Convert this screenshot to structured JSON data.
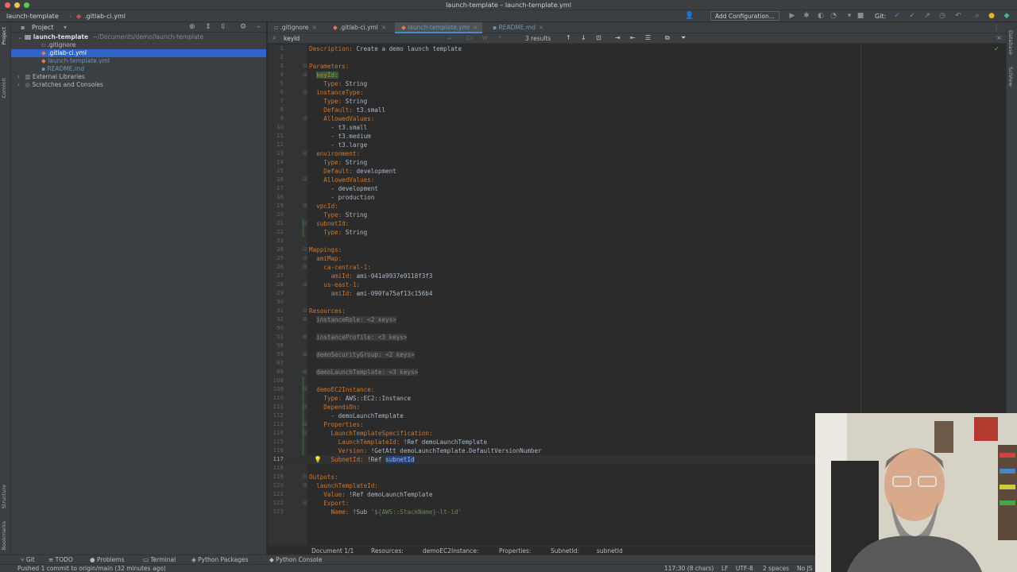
{
  "window": {
    "title": "launch-template – launch-template.yml"
  },
  "navbar": {
    "project": "launch-template",
    "file": ".gitlab-ci.yml",
    "add_configuration": "Add Configuration...",
    "git_label": "Git:"
  },
  "left_strip": {
    "project_tab": "Project",
    "commit_tab": "Commit",
    "structure_tab": "Structure",
    "bookmarks_tab": "Bookmarks"
  },
  "right_strip": {
    "database_tab": "Database",
    "sciview_tab": "SciView"
  },
  "project_panel": {
    "header": "Project",
    "root_name": "launch-template",
    "root_path": "~/Documents/demo/launch-template",
    "files": [
      {
        "name": ".gitignore"
      },
      {
        "name": ".gitlab-ci.yml"
      },
      {
        "name": "launch-template.yml"
      },
      {
        "name": "README.md"
      }
    ],
    "external_libraries": "External Libraries",
    "scratches": "Scratches and Consoles"
  },
  "tabs": [
    {
      "label": ".gitignore"
    },
    {
      "label": ".gitlab-ci.yml"
    },
    {
      "label": "launch-template.yml"
    },
    {
      "label": "README.md"
    }
  ],
  "search": {
    "value": "keyId",
    "result_count": "3 results"
  },
  "code_lines": [
    {
      "n": "1",
      "text": "Description: Create a demo launch template"
    },
    {
      "n": "2",
      "text": ""
    },
    {
      "n": "3",
      "text": "Parameters:"
    },
    {
      "n": "4",
      "text": "  keyId:"
    },
    {
      "n": "5",
      "text": "    Type: String"
    },
    {
      "n": "6",
      "text": "  instanceType:"
    },
    {
      "n": "7",
      "text": "    Type: String"
    },
    {
      "n": "8",
      "text": "    Default: t3.small"
    },
    {
      "n": "9",
      "text": "    AllowedValues:"
    },
    {
      "n": "10",
      "text": "      - t3.small"
    },
    {
      "n": "11",
      "text": "      - t3.medium"
    },
    {
      "n": "12",
      "text": "      - t3.large"
    },
    {
      "n": "13",
      "text": "  environment:"
    },
    {
      "n": "14",
      "text": "    Type: String"
    },
    {
      "n": "15",
      "text": "    Default: development"
    },
    {
      "n": "16",
      "text": "    AllowedValues:"
    },
    {
      "n": "17",
      "text": "      - development"
    },
    {
      "n": "18",
      "text": "      - production"
    },
    {
      "n": "19",
      "text": "  vpcId:"
    },
    {
      "n": "20",
      "text": "    Type: String"
    },
    {
      "n": "21",
      "text": "  subnetId:"
    },
    {
      "n": "22",
      "text": "    Type: String"
    },
    {
      "n": "23",
      "text": ""
    },
    {
      "n": "24",
      "text": "Mappings:"
    },
    {
      "n": "25",
      "text": "  amiMap:"
    },
    {
      "n": "26",
      "text": "    ca-central-1:"
    },
    {
      "n": "27",
      "text": "      amiId: ami-041a9937e9118f3f3"
    },
    {
      "n": "28",
      "text": "    us-east-1:"
    },
    {
      "n": "29",
      "text": "      amiId: ami-090fa75af13c156b4"
    },
    {
      "n": "30",
      "text": ""
    },
    {
      "n": "31",
      "text": "Resources:"
    },
    {
      "n": "32",
      "text": "  instanceRole: <2 keys>"
    },
    {
      "n": "50",
      "text": ""
    },
    {
      "n": "51",
      "text": "  instanceProfile: <3 keys>"
    },
    {
      "n": "58",
      "text": ""
    },
    {
      "n": "59",
      "text": "  demoSecurityGroup: <2 keys>"
    },
    {
      "n": "67",
      "text": ""
    },
    {
      "n": "68",
      "text": "  demoLaunchTemplate: <3 keys>"
    },
    {
      "n": "108",
      "text": ""
    },
    {
      "n": "109",
      "text": "  demoEC2Instance:"
    },
    {
      "n": "110",
      "text": "    Type: AWS::EC2::Instance"
    },
    {
      "n": "111",
      "text": "    DependsOn:"
    },
    {
      "n": "112",
      "text": "      - demoLaunchTemplate"
    },
    {
      "n": "113",
      "text": "    Properties:"
    },
    {
      "n": "114",
      "text": "      LaunchTemplateSpecification:"
    },
    {
      "n": "115",
      "text": "        LaunchTemplateId: !Ref demoLaunchTemplate"
    },
    {
      "n": "116",
      "text": "        Version: !GetAtt demoLaunchTemplate.DefaultVersionNumber"
    },
    {
      "n": "117",
      "text": "      SubnetId: !Ref subnetId"
    },
    {
      "n": "118",
      "text": ""
    },
    {
      "n": "119",
      "text": "Outputs:"
    },
    {
      "n": "120",
      "text": "  launchTemplateId:"
    },
    {
      "n": "121",
      "text": "    Value: !Ref demoLaunchTemplate"
    },
    {
      "n": "122",
      "text": "    Export:"
    },
    {
      "n": "123",
      "text": "      Name: !Sub '${AWS::StackName}-lt-id'"
    }
  ],
  "breadcrumb": [
    "Document 1/1",
    "Resources:",
    "demoEC2Instance:",
    "Properties:",
    "SubnetId:",
    "subnetId"
  ],
  "bottom_tools": [
    "Git",
    "TODO",
    "Problems",
    "Terminal",
    "Python Packages",
    "Python Console"
  ],
  "status": {
    "message": "Pushed 1 commit to origin/main (32 minutes ago)",
    "position": "117:30 (8 chars)",
    "line_sep": "LF",
    "encoding": "UTF-8",
    "indent": "2 spaces",
    "interpreter": "No JS"
  },
  "colors": {
    "selection": "#2f65ca",
    "search_hl": "#32593d",
    "key": "#cc7832",
    "string": "#6a8759"
  }
}
